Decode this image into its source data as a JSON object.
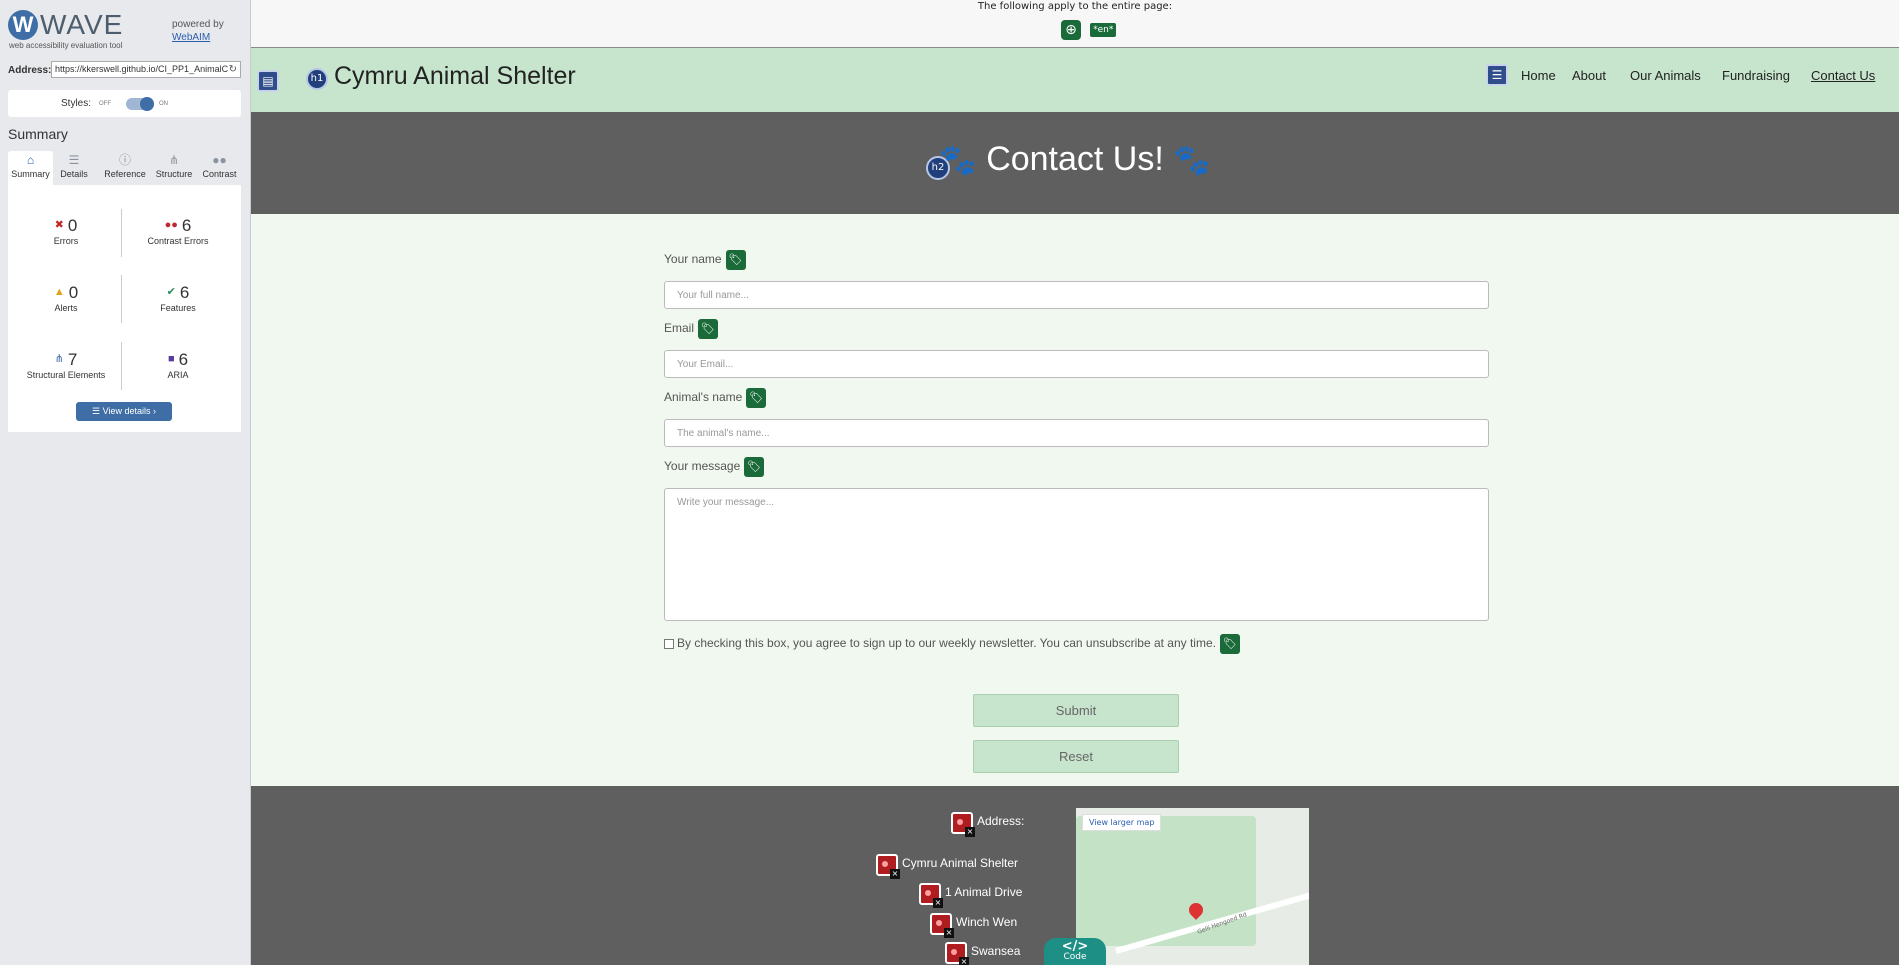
{
  "wave": {
    "logo_letter": "W",
    "logo_name": "WAVE",
    "tagline": "web accessibility evaluation tool",
    "powered_by": "powered by",
    "webaim": "WebAIM",
    "address_label": "Address:",
    "address_value": "https://kkerswell.github.io/CI_PP1_AnimalC",
    "styles_label": "Styles:",
    "styles_off": "OFF",
    "styles_on": "ON",
    "summary_title": "Summary",
    "tabs": [
      {
        "label": "Summary",
        "icon": "⌂"
      },
      {
        "label": "Details",
        "icon": "☰"
      },
      {
        "label": "Reference",
        "icon": "ⓘ"
      },
      {
        "label": "Structure",
        "icon": "⋔"
      },
      {
        "label": "Contrast",
        "icon": "●●"
      }
    ],
    "stats": {
      "errors": {
        "count": "0",
        "label": "Errors"
      },
      "contrast_errors": {
        "count": "6",
        "label": "Contrast Errors"
      },
      "alerts": {
        "count": "0",
        "label": "Alerts"
      },
      "features": {
        "count": "6",
        "label": "Features"
      },
      "structural": {
        "count": "7",
        "label": "Structural Elements"
      },
      "aria": {
        "count": "6",
        "label": "ARIA"
      }
    },
    "view_details": "View details ›"
  },
  "page": {
    "banner_text": "The following apply to the entire page:",
    "lang_badge": "*en*",
    "h1_badge": "h1",
    "h2_badge": "h2",
    "site_title": "Cymru Animal Shelter",
    "nav": [
      "Home",
      "About",
      "Our Animals",
      "Fundraising",
      "Contact Us"
    ],
    "hero_title": "Contact Us!",
    "form": {
      "name_label": "Your name",
      "name_placeholder": "Your full name...",
      "email_label": "Email",
      "email_placeholder": "Your Email...",
      "animal_label": "Animal's name",
      "animal_placeholder": "The animal's name...",
      "message_label": "Your message",
      "message_placeholder": "Write your message...",
      "newsletter_label": "By checking this box, you agree to sign up to our weekly newsletter. You can unsubscribe at any time.",
      "submit": "Submit",
      "reset": "Reset"
    },
    "footer": {
      "address_label": "Address:",
      "lines": [
        "Cymru Animal Shelter",
        "1 Animal Drive",
        "Winch Wen",
        "Swansea"
      ],
      "map_larger": "View larger map",
      "map_road": "Gelli Hengoed Rd",
      "code_symbol": "</>",
      "code_label": "Code"
    }
  }
}
